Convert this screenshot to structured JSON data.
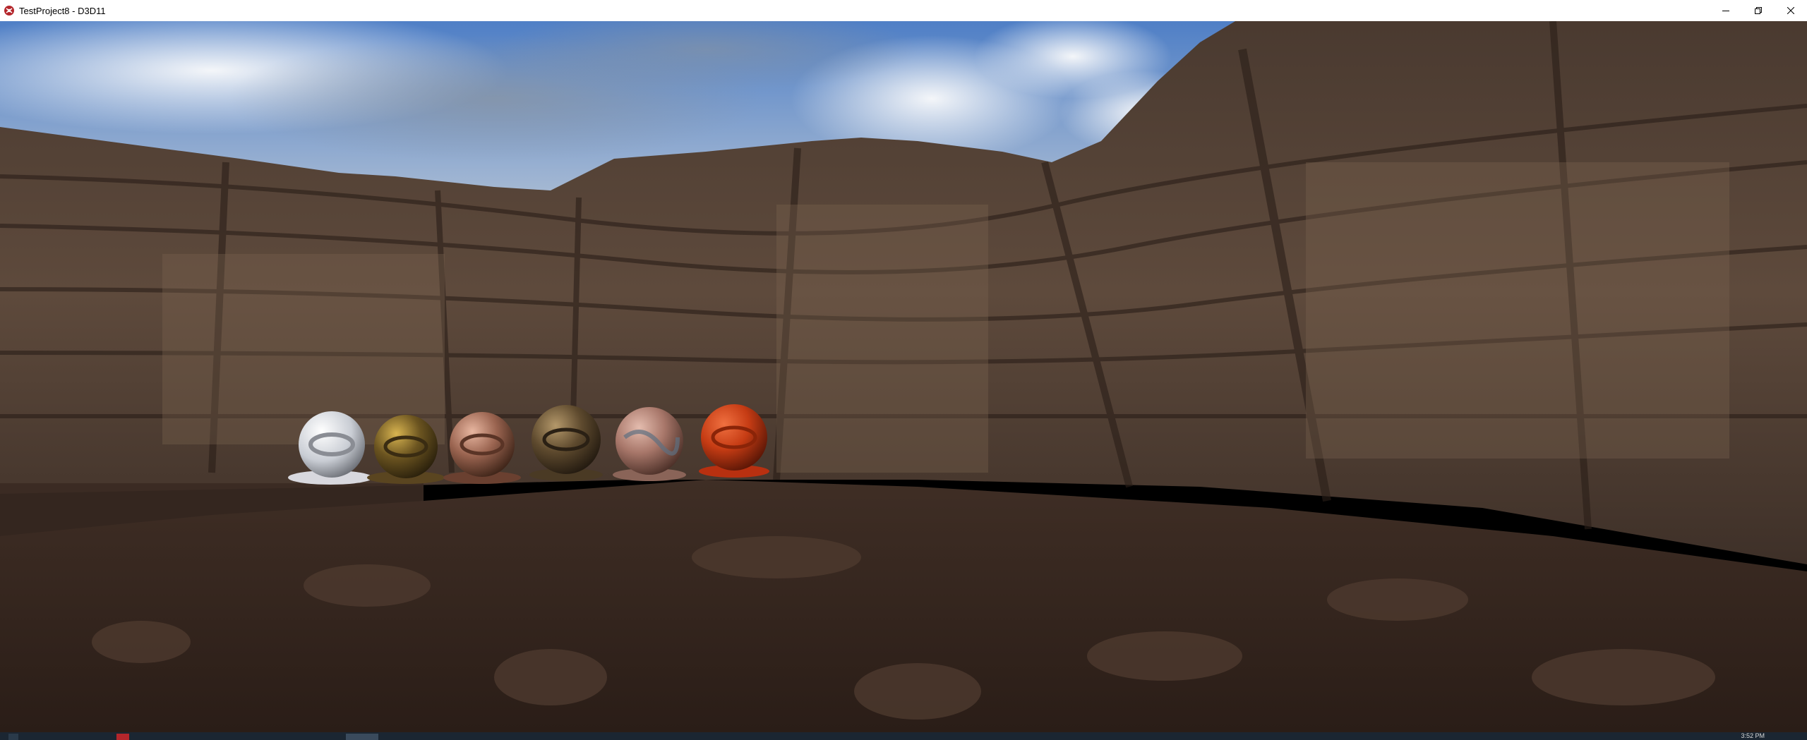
{
  "window": {
    "title": "TestProject8 - D3D11",
    "icon": "app-icon",
    "controls": [
      "minimize-icon",
      "restore-icon",
      "close-icon"
    ]
  },
  "scene": {
    "description_objects": [
      "white-sphere",
      "gold-sphere",
      "copper-sphere",
      "bronze-sphere",
      "marble-sphere",
      "red-sphere"
    ],
    "colors": {
      "sky_top": "#5a86c8",
      "cloud": "#e8ecf2",
      "rock_light": "#6e5a4a",
      "rock_dark": "#2a1e18",
      "ground": "#3b2b22"
    }
  },
  "taskbar": {
    "clock": "3:52 PM"
  }
}
